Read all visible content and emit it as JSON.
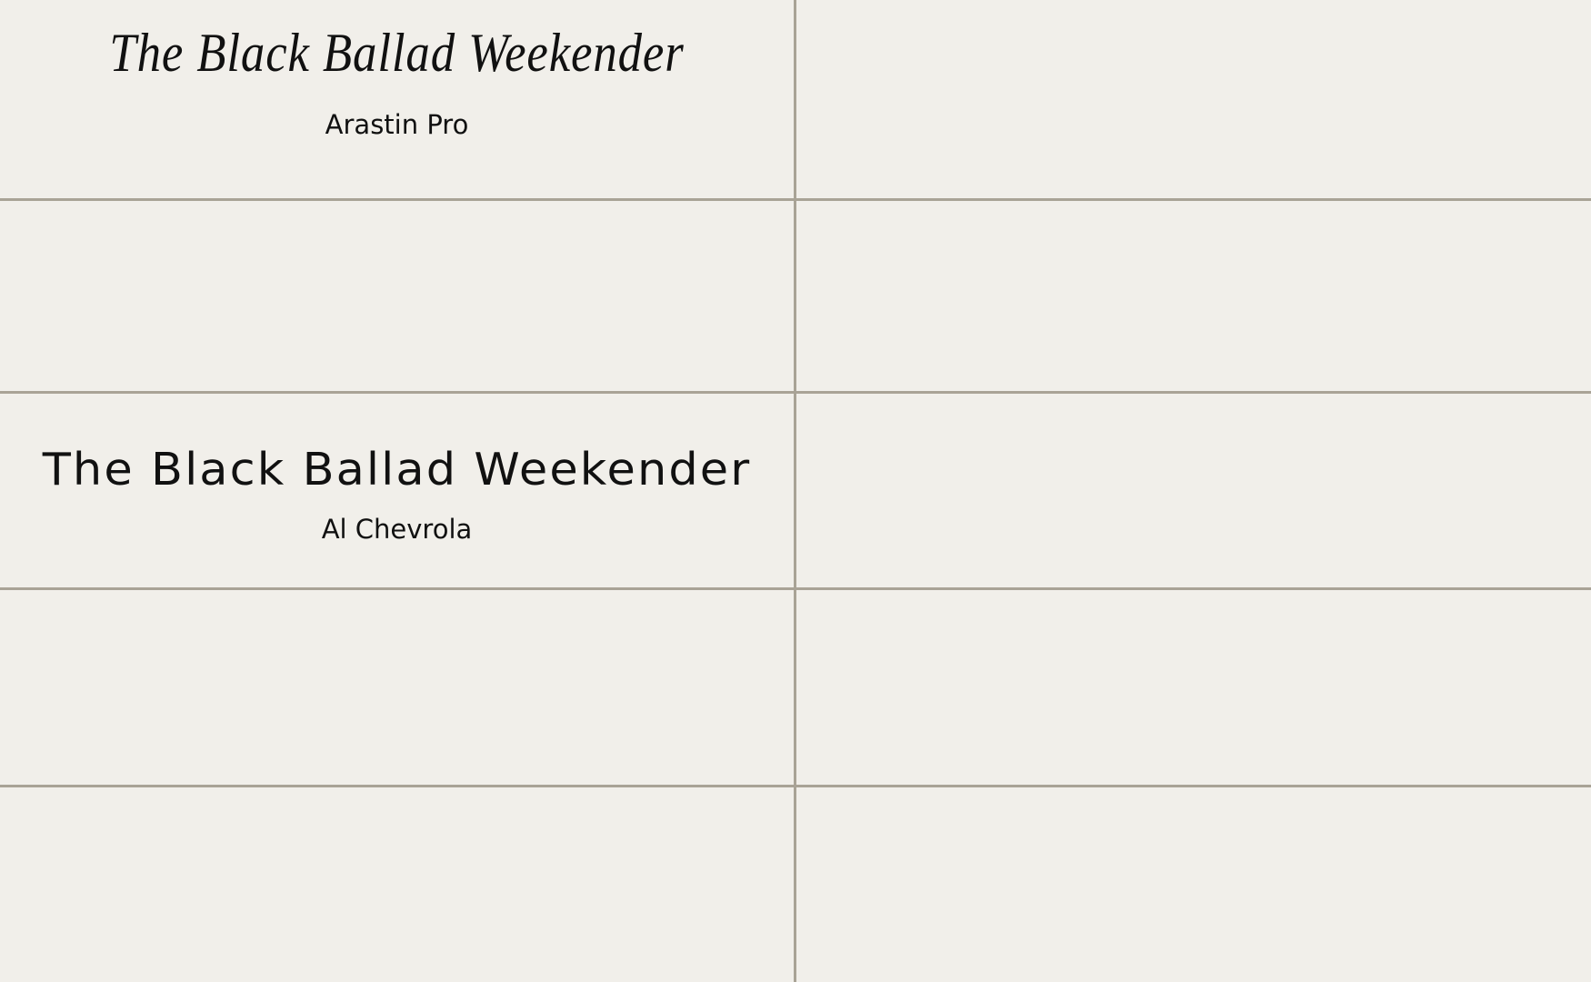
{
  "samples": [
    {
      "sample_text": "The Black Ballad Weekender",
      "font_name": "Arastin Pro"
    },
    {
      "sample_text": "The Black Ballad Weekender",
      "font_name": "Al Chevrola"
    }
  ],
  "colors": {
    "background": "#f1efea",
    "grid_lines": "#a9a396",
    "text": "#111111"
  }
}
